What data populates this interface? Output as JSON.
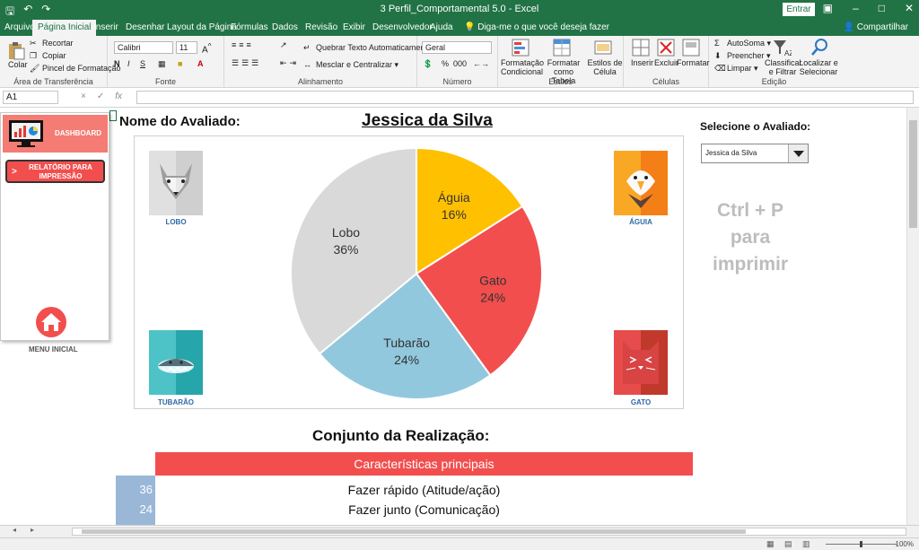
{
  "window": {
    "title": "3 Perfil_Comportamental 5.0 - Excel",
    "signin": "Entrar",
    "share": "Compartilhar"
  },
  "ribbon_tabs": [
    "Arquivo",
    "Página Inicial",
    "Inserir",
    "Desenhar",
    "Layout da Página",
    "Fórmulas",
    "Dados",
    "Revisão",
    "Exibir",
    "Desenvolvedor",
    "Ajuda"
  ],
  "tell_me": "Diga-me o que você deseja fazer",
  "ribbon": {
    "clipboard": {
      "paste": "Colar",
      "cut": "Recortar",
      "copy": "Copiar",
      "format_painter": "Pincel de Formatação",
      "label": "Área de Transferência"
    },
    "font": {
      "name": "Calibri",
      "size": "11",
      "bold": "N",
      "italic": "I",
      "underline": "S",
      "label": "Fonte"
    },
    "alignment": {
      "wrap": "Quebrar Texto Automaticamente",
      "merge": "Mesclar e Centralizar",
      "label": "Alinhamento"
    },
    "number": {
      "format": "Geral",
      "percent": "%",
      "thousands": "000",
      "label": "Número"
    },
    "styles": {
      "conditional": "Formatação Condicional",
      "table": "Formatar como Tabela",
      "cell_styles": "Estilos de Célula",
      "label": "Estilos"
    },
    "cells": {
      "insert": "Inserir",
      "delete": "Excluir",
      "format": "Formatar",
      "label": "Células"
    },
    "editing": {
      "autosum": "AutoSoma",
      "fill": "Preencher",
      "clear": "Limpar",
      "sort": "Classificar e Filtrar",
      "find": "Localizar e Selecionar",
      "label": "Edição"
    }
  },
  "formula_bar": {
    "cell_ref": "A1",
    "fx": "fx",
    "cancel": "×",
    "enter": "✓",
    "value": ""
  },
  "panel": {
    "dashboard": "DASHBOARD",
    "report": "RELATÓRIO PARA IMPRESSÃO",
    "report_arrow": ">",
    "home": "MENU INICIAL"
  },
  "sheet": {
    "name_label": "Nome do Avaliado:",
    "evaluated_name": "Jessica da Silva",
    "select_label": "Selecione o Avaliado:",
    "select_value": "Jessica da Silva",
    "ctrl_p": [
      "Ctrl + P",
      "para",
      "imprimir"
    ],
    "achievement_title": "Conjunto da Realização:",
    "char_header": "Características principais",
    "rows": [
      {
        "num": "36",
        "text": "Fazer rápido (Atitude/ação)"
      },
      {
        "num": "24",
        "text": "Fazer junto (Comunicação)"
      }
    ]
  },
  "animals": [
    {
      "label": "LOBO"
    },
    {
      "label": "ÁGUIA"
    },
    {
      "label": "TUBARÃO"
    },
    {
      "label": "GATO"
    }
  ],
  "chart_data": {
    "type": "pie",
    "categories": [
      "Águia",
      "Gato",
      "Tubarão",
      "Lobo"
    ],
    "values": [
      16,
      24,
      24,
      36
    ],
    "labels": [
      "16%",
      "24%",
      "24%",
      "36%"
    ],
    "colors": [
      "#FFC000",
      "#F24E4E",
      "#92C8DE",
      "#D9D9D9"
    ]
  },
  "status": {
    "zoom": "100%"
  }
}
